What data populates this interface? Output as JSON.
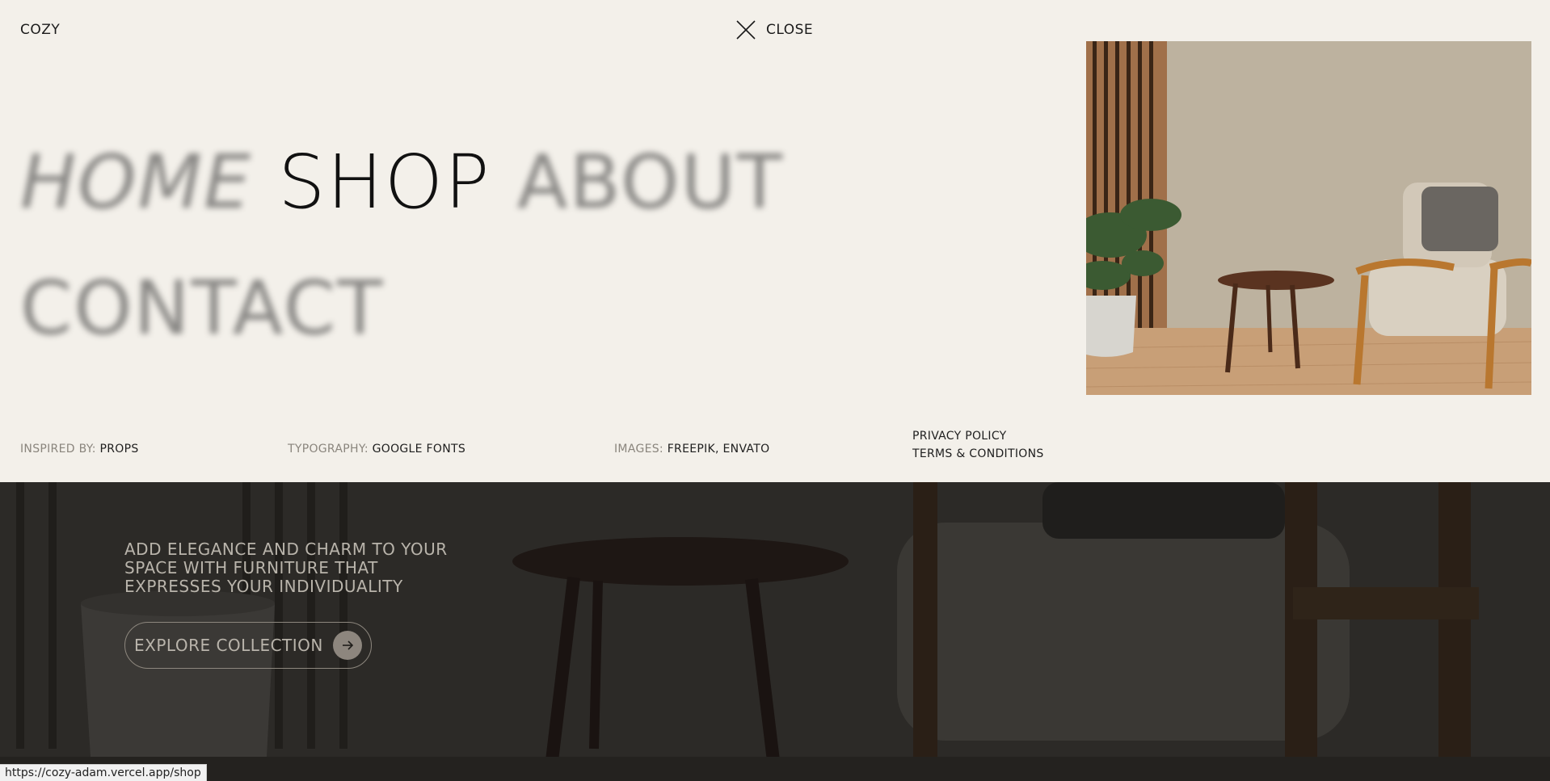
{
  "brand": "COZY",
  "close_label": "CLOSE",
  "nav": {
    "home": "HOME",
    "shop": "SHOP",
    "about": "ABOUT",
    "contact": "CONTACT"
  },
  "credits": {
    "inspired_label": "INSPIRED BY:",
    "inspired_value": "PROPS",
    "typography_label": "TYPOGRAPHY:",
    "typography_value": "GOOGLE FONTS",
    "images_label": "IMAGES:",
    "images_value": "FREEPIK, ENVATO"
  },
  "legal": {
    "privacy": "PRIVACY POLICY",
    "terms": "TERMS & CONDITIONS"
  },
  "hero": {
    "copy": "ADD ELEGANCE AND CHARM TO YOUR SPACE WITH FURNITURE THAT EXPRESSES YOUR INDIVIDUALITY",
    "cta": "EXPLORE COLLECTION"
  },
  "status_url": "https://cozy-adam.vercel.app/shop",
  "icons": [
    "close-icon",
    "arrow-right-icon"
  ],
  "colors": {
    "background": "#f3f0ea",
    "text": "#111111",
    "muted": "#8a857d",
    "hero": "#2b2926"
  }
}
